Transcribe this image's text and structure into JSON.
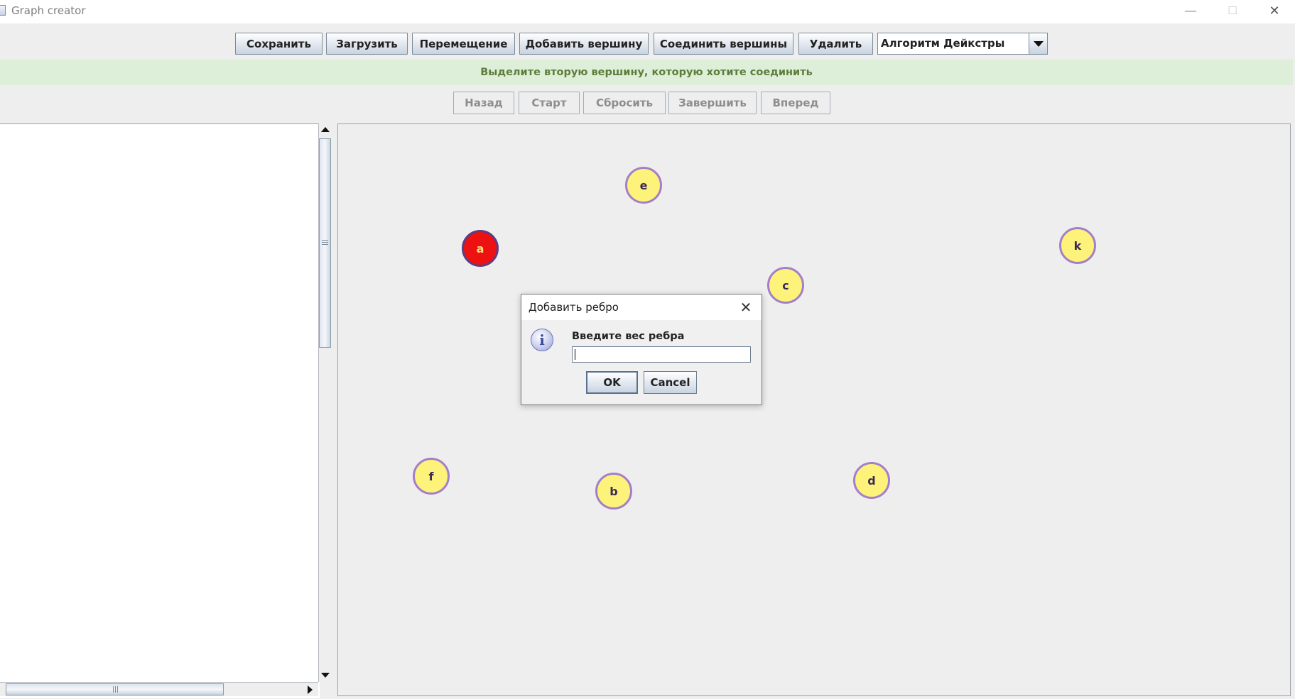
{
  "window": {
    "title": "Graph creator",
    "minimize_glyph": "—",
    "maximize_glyph": "☐",
    "close_glyph": "✕"
  },
  "toolbar": {
    "save": "Сохранить",
    "load": "Загрузить",
    "move": "Перемещение",
    "add_vertex": "Добавить вершину",
    "connect_vertices": "Соединить вершины",
    "delete": "Удалить",
    "algorithm_selected": "Алгоритм Дейкстры"
  },
  "status_message": "Выделите вторую вершину, которую хотите соединить",
  "steps": {
    "back": "Назад",
    "start": "Старт",
    "reset": "Сбросить",
    "finish": "Завершить",
    "forward": "Вперед"
  },
  "graph": {
    "vertices": [
      {
        "label": "e",
        "selected": false
      },
      {
        "label": "a",
        "selected": true
      },
      {
        "label": "k",
        "selected": false
      },
      {
        "label": "c",
        "selected": false
      },
      {
        "label": "f",
        "selected": false
      },
      {
        "label": "b",
        "selected": false
      },
      {
        "label": "d",
        "selected": false
      }
    ]
  },
  "dialog": {
    "title": "Добавить ребро",
    "message": "Введите вес ребра",
    "input_value": "",
    "ok": "OK",
    "cancel": "Cancel",
    "close_glyph": "✕",
    "icon_glyph": "i"
  },
  "colors": {
    "vertex_fill": "#fdf27a",
    "vertex_border": "#a37fc8",
    "selected_fill": "#ee1111",
    "status_bg": "#ddeed9",
    "status_text": "#5e7d3a"
  }
}
